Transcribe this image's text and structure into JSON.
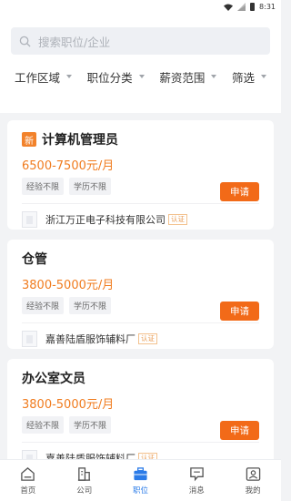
{
  "statusbar": {
    "time": "8:31"
  },
  "search": {
    "placeholder": "搜索职位/企业"
  },
  "filters": [
    {
      "label": "工作区域"
    },
    {
      "label": "职位分类"
    },
    {
      "label": "薪资范围"
    },
    {
      "label": "筛选"
    }
  ],
  "jobs": [
    {
      "badge": "新",
      "title": "计算机管理员",
      "salary": "6500-7500元/月",
      "tags": [
        "经验不限",
        "学历不限"
      ],
      "apply": "申请",
      "company": "浙江万正电子科技有限公司",
      "verified": "认证"
    },
    {
      "badge": "",
      "title": "仓管",
      "salary": "3800-5000元/月",
      "tags": [
        "经验不限",
        "学历不限"
      ],
      "apply": "申请",
      "company": "嘉善陆盾服饰辅料厂",
      "verified": "认证"
    },
    {
      "badge": "",
      "title": "办公室文员",
      "salary": "3800-5000元/月",
      "tags": [
        "经验不限",
        "学历不限"
      ],
      "apply": "申请",
      "company": "嘉善陆盾服饰辅料厂",
      "verified": "认证"
    }
  ],
  "tabbar": [
    {
      "label": "首页",
      "icon": "home-icon"
    },
    {
      "label": "公司",
      "icon": "building-icon"
    },
    {
      "label": "职位",
      "icon": "briefcase-icon",
      "active": true
    },
    {
      "label": "消息",
      "icon": "message-icon"
    },
    {
      "label": "我的",
      "icon": "profile-icon"
    }
  ],
  "colors": {
    "accent": "#2a7be8",
    "salary": "#f07c1f",
    "apply": "#f26a18",
    "new_badge": "#f2822b"
  }
}
